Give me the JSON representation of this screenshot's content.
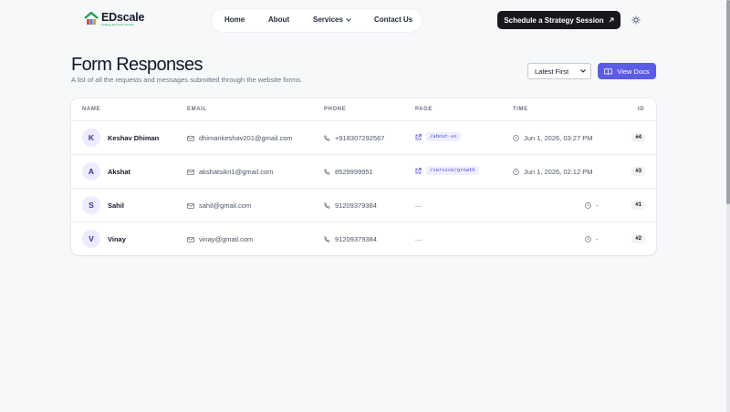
{
  "brand": {
    "name": "EDscale",
    "tagline": "Strategy.Execution.Growth"
  },
  "nav": {
    "items": [
      "Home",
      "About",
      "Services",
      "Contact Us"
    ]
  },
  "cta": {
    "label": "Schedule a Strategy Session"
  },
  "page": {
    "title": "Form Responses",
    "subtitle": "A list of all the requests and messages submitted through the website forms."
  },
  "controls": {
    "sort_selected": "Latest First",
    "docs_label": "View Docs"
  },
  "table": {
    "columns": [
      "NAME",
      "EMAIL",
      "PHONE",
      "PAGE",
      "TIME",
      "ID"
    ],
    "rows": [
      {
        "initial": "K",
        "name": "Keshav Dhiman",
        "email": "dhimankeshav201@gmail.com",
        "phone": "+918307292567",
        "page": "/about-us",
        "time": "Jun 1, 2026, 03:27 PM",
        "id": "#4"
      },
      {
        "initial": "A",
        "name": "Akshat",
        "email": "akshatsikri1@gmail.com",
        "phone": "8529999951",
        "page": "/service/growth",
        "time": "Jun 1, 2026, 02:12 PM",
        "id": "#3"
      },
      {
        "initial": "S",
        "name": "Sahil",
        "email": "sahil@gmail.com",
        "phone": "91209379384",
        "page": "—",
        "time": "-",
        "id": "#1"
      },
      {
        "initial": "V",
        "name": "Vinay",
        "email": "vinay@gmail.com",
        "phone": "91209379384",
        "page": "—",
        "time": "-",
        "id": "#2"
      }
    ]
  },
  "colors": {
    "accent": "#5b5be6",
    "cta_bg": "#16181d",
    "avatar_bg": "#ecebff",
    "page_chip_bg": "#eef0ff"
  },
  "icons": [
    "logo-house-icon",
    "chevron-down-icon",
    "arrow-up-right-icon",
    "sun-icon",
    "book-icon",
    "mail-icon",
    "phone-icon",
    "external-link-icon",
    "clock-icon"
  ]
}
